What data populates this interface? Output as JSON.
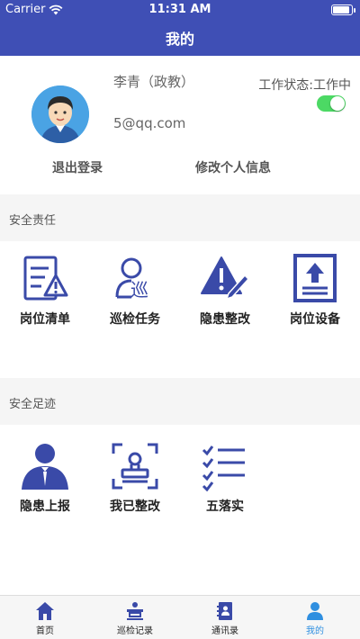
{
  "status_bar": {
    "carrier": "Carrier",
    "time": "11:31 AM"
  },
  "nav": {
    "title": "我的"
  },
  "profile": {
    "name": "李青（政教）",
    "email": "5@qq.com",
    "work_status": "工作状态:工作中",
    "work_toggle_on": true,
    "logout": "退出登录",
    "edit_info": "修改个人信息"
  },
  "sections": {
    "safety_duty": {
      "title": "安全责任",
      "items": [
        {
          "label": "岗位清单",
          "icon": "checklist-warning-icon"
        },
        {
          "label": "巡检任务",
          "icon": "inspector-icon"
        },
        {
          "label": "隐患整改",
          "icon": "warning-edit-icon"
        },
        {
          "label": "岗位设备",
          "icon": "upload-board-icon"
        }
      ]
    },
    "safety_trace": {
      "title": "安全足迹",
      "items": [
        {
          "label": "隐患上报",
          "icon": "person-report-icon"
        },
        {
          "label": "我已整改",
          "icon": "stamp-frame-icon"
        },
        {
          "label": "五落实",
          "icon": "check-list-icon"
        }
      ]
    }
  },
  "tabbar": {
    "items": [
      {
        "label": "首页",
        "icon": "home-icon"
      },
      {
        "label": "巡检记录",
        "icon": "inspection-record-icon"
      },
      {
        "label": "通讯录",
        "icon": "contacts-icon"
      },
      {
        "label": "我的",
        "icon": "user-icon",
        "active": true
      }
    ]
  },
  "colors": {
    "primary": "#3f4fb5",
    "icon": "#3a4aa8",
    "toggle": "#4cd964",
    "active_tab": "#2f8fe0"
  }
}
